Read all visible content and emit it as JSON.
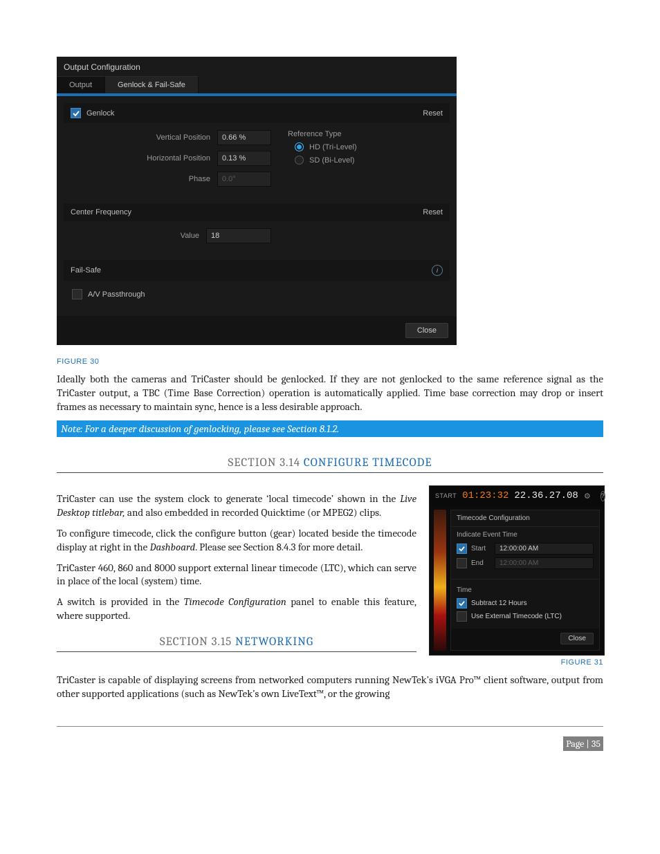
{
  "dialog1": {
    "title": "Output Configuration",
    "tabs": {
      "output": "Output",
      "genlock": "Genlock & Fail-Safe"
    },
    "genlock": {
      "header_label": "Genlock",
      "reset": "Reset",
      "vertical_label": "Vertical Position",
      "vertical_value": "0.66 %",
      "horizontal_label": "Horizontal Position",
      "horizontal_value": "0.13 %",
      "phase_label": "Phase",
      "phase_value": "0.0°",
      "reference_label": "Reference Type",
      "radio_hd": "HD (Tri-Level)",
      "radio_sd": "SD (Bi-Level)"
    },
    "center_freq": {
      "header_label": "Center Frequency",
      "reset": "Reset",
      "value_label": "Value",
      "value": "18"
    },
    "failsafe": {
      "header_label": "Fail-Safe",
      "passthrough_label": "A/V Passthrough"
    },
    "close_btn": "Close"
  },
  "captions": {
    "fig30": "FIGURE 30",
    "fig31": "FIGURE 31"
  },
  "paragraphs": {
    "p1": "Ideally both the cameras and TriCaster should be genlocked.  If they are not genlocked to the same reference signal as the TriCaster output, a TBC (Time Base Correction) operation is automatically applied.  Time base correction may drop or insert frames as necessary to maintain sync, hence is a less desirable approach.",
    "note": "Note: For a deeper discussion of genlocking, please see Section 8.1.2.",
    "p2a": "TriCaster can use the system clock to generate ‘local timecode’ shown in the ",
    "p2b": "Live Desktop titlebar,",
    "p2c": " and also embedded in recorded Quicktime (or MPEG2) clips.",
    "p3a": "To configure timecode, click the configure button (gear) located beside the timecode display at right in the ",
    "p3b": "Dashboard",
    "p3c": ".  Please see Section 8.4.3 for more detail.",
    "p4": "TriCaster 460, 860 and 8000 support external linear timecode (LTC), which can serve in place of the local (system) time.",
    "p5a": "A switch is provided in the ",
    "p5b": "Timecode Configuration",
    "p5c": " panel to enable this feature, where supported.",
    "p6": "TriCaster is capable of displaying screens from networked computers running NewTek’s iVGA Pro™ client software, output from other supported applications (such as NewTek’s own LiveText™, or the growing"
  },
  "sections": {
    "s314_label": "SECTION 3.14",
    "s314_title": "CONFIGURE TIMECODE",
    "s315_label": "SECTION 3.15",
    "s315_title": "NETWORKING"
  },
  "timecode_shot": {
    "start_label": "START",
    "time_orange": "01:23:32",
    "time_white": "22.36.27.08",
    "panel_title": "Timecode Configuration",
    "event_header": "Indicate Event Time",
    "start_row_label": "Start",
    "start_value": "12:00:00 AM",
    "end_row_label": "End",
    "end_value": "12:00:00 AM",
    "time_header": "Time",
    "subtract_label": "Subtract 12 Hours",
    "external_label": "Use External Timecode (LTC)",
    "close": "Close"
  },
  "footer": {
    "page": "Page | 35"
  }
}
